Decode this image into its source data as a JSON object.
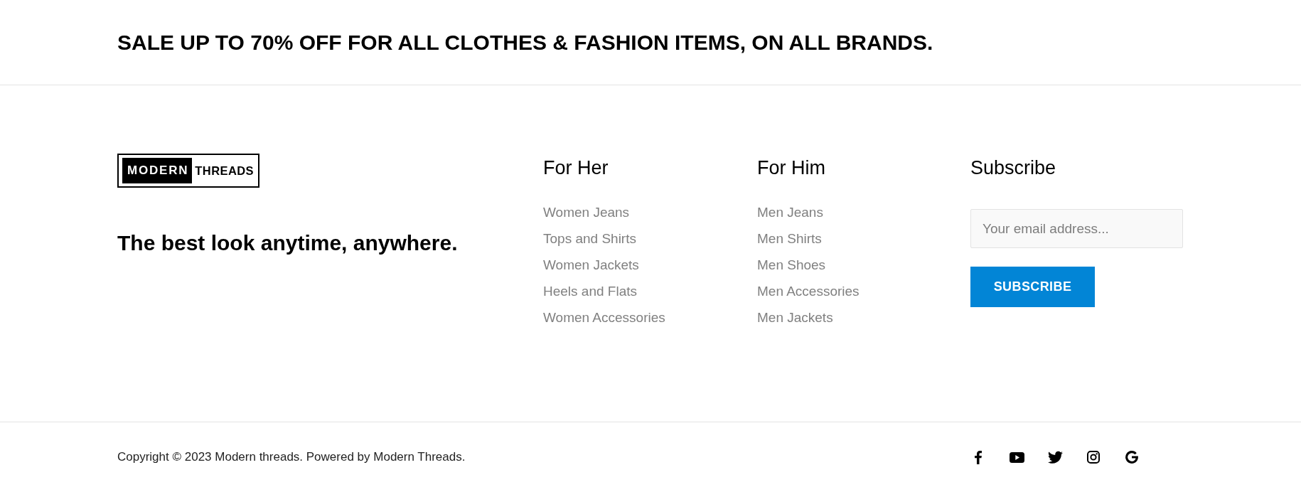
{
  "banner": {
    "text": "SALE UP TO 70% OFF FOR ALL CLOTHES & FASHION ITEMS, ON ALL BRANDS."
  },
  "brand": {
    "logo_words": [
      {
        "text": "MODERN",
        "highlighted": true
      },
      {
        "text": "THREADS",
        "highlighted": false
      }
    ],
    "tagline": "The best look anytime, anywhere."
  },
  "link_columns": [
    {
      "heading": "For Her",
      "links": [
        "Women Jeans",
        "Tops and Shirts",
        "Women Jackets",
        "Heels and Flats",
        "Women Accessories"
      ]
    },
    {
      "heading": "For Him",
      "links": [
        "Men Jeans",
        "Men Shirts",
        "Men Shoes",
        "Men Accessories",
        "Men Jackets"
      ]
    }
  ],
  "subscribe": {
    "heading": "Subscribe",
    "placeholder": "Your email address...",
    "button": "SUBSCRIBE"
  },
  "bottom_bar": {
    "copyright": "Copyright © 2023 Modern threads. Powered by Modern Threads.",
    "social_links": [
      {
        "kind": "facebook"
      },
      {
        "kind": "youtube"
      },
      {
        "kind": "twitter"
      },
      {
        "kind": "instagram"
      },
      {
        "kind": "google"
      }
    ]
  }
}
